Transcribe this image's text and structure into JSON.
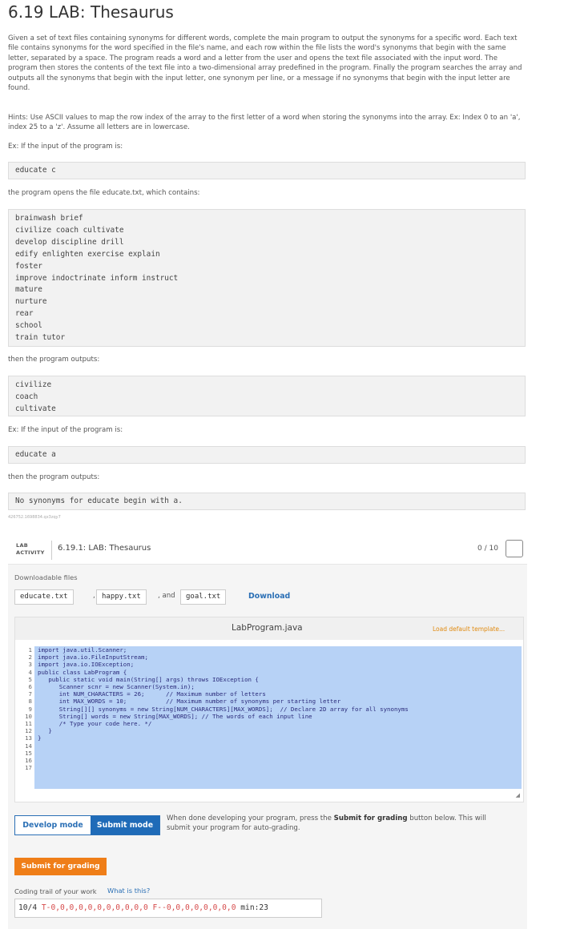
{
  "title": "6.19 LAB: Thesaurus",
  "description": {
    "p1": "Given a set of text files containing synonyms for different words, complete the main program to output the synonyms for a specific word. Each text file contains synonyms for the word specified in the file's name, and each row within the file lists the word's synonyms that begin with the same letter, separated by a space. The program reads a word and a letter from the user and opens the text file associated with the input word. The program then stores the contents of the text file into a two-dimensional array predefined in the program. Finally the program searches the array and outputs all the synonyms that begin with the input letter, one synonym per line, or a message if no synonyms that begin with the input letter are found.",
    "p2": "Hints: Use ASCII values to map the row index of the array to the first letter of a word when storing the synonyms into the array. Ex: Index 0 to an 'a', index 25 to a 'z'. Assume all letters are in lowercase.",
    "ex1_intro": "Ex: If the input of the program is:",
    "ex1_input": "educate c",
    "file_intro": "the program opens the file educate.txt, which contains:",
    "file_lines": [
      "brainwash brief",
      "civilize coach cultivate",
      "develop discipline drill",
      "edify enlighten exercise explain",
      "foster",
      "improve indoctrinate inform instruct",
      "mature",
      "nurture",
      "rear",
      "school",
      "train tutor"
    ],
    "out1_intro": "then the program outputs:",
    "out1_lines": [
      "civilize",
      "coach",
      "cultivate"
    ],
    "ex2_intro": "Ex: If the input of the program is:",
    "ex2_input": "educate a",
    "out2_intro": "then the program outputs:",
    "out2_line": "No synonyms for educate begin with a."
  },
  "ident": "426752.1698834.qx3zqy7",
  "lab": {
    "badge_line1": "LAB",
    "badge_line2": "ACTIVITY",
    "title": "6.19.1: LAB: Thesaurus",
    "score": "0 / 10",
    "downloadable_label": "Downloadable files",
    "files": [
      "educate.txt",
      "happy.txt",
      "goal.txt"
    ],
    "sep_comma": ",",
    "sep_and": ", and",
    "download_label": "Download",
    "editor_filename": "LabProgram.java",
    "load_template": "Load default template...",
    "line_numbers": [
      "1",
      "2",
      "3",
      "4",
      "5",
      "6",
      "7",
      "8",
      "9",
      "10",
      "11",
      "12",
      "13",
      "14",
      "15",
      "16",
      "17"
    ],
    "code_lines": [
      "import java.util.Scanner;",
      "import java.io.FileInputStream;",
      "import java.io.IOException;",
      "",
      "public class LabProgram {",
      "   public static void main(String[] args) throws IOException {",
      "      Scanner scnr = new Scanner(System.in);",
      "      int NUM_CHARACTERS = 26;      // Maximum number of letters",
      "      int MAX_WORDS = 10;           // Maximum number of synonyms per starting letter",
      "",
      "      String[][] synonyms = new String[NUM_CHARACTERS][MAX_WORDS];  // Declare 2D array for all synonyms",
      "      String[] words = new String[MAX_WORDS]; // The words of each input line",
      "",
      "      /* Type your code here. */",
      "   }",
      "}",
      ""
    ],
    "develop_mode": "Develop mode",
    "submit_mode": "Submit mode",
    "mode_note_pre": "When done developing your program, press the ",
    "mode_note_bold": "Submit for grading",
    "mode_note_post": " button below. This will submit your program for auto-grading.",
    "submit_grading": "Submit for grading",
    "trail_label": "Coding trail of your work",
    "what_is_this": "What is this?",
    "trail_date": "10/4 ",
    "trail_t": "T-0,0,0,0,0,0,0,0,0,0,0 ",
    "trail_f": "F--0,0,0,0,0,0,0,0 ",
    "trail_min": "min:23"
  }
}
